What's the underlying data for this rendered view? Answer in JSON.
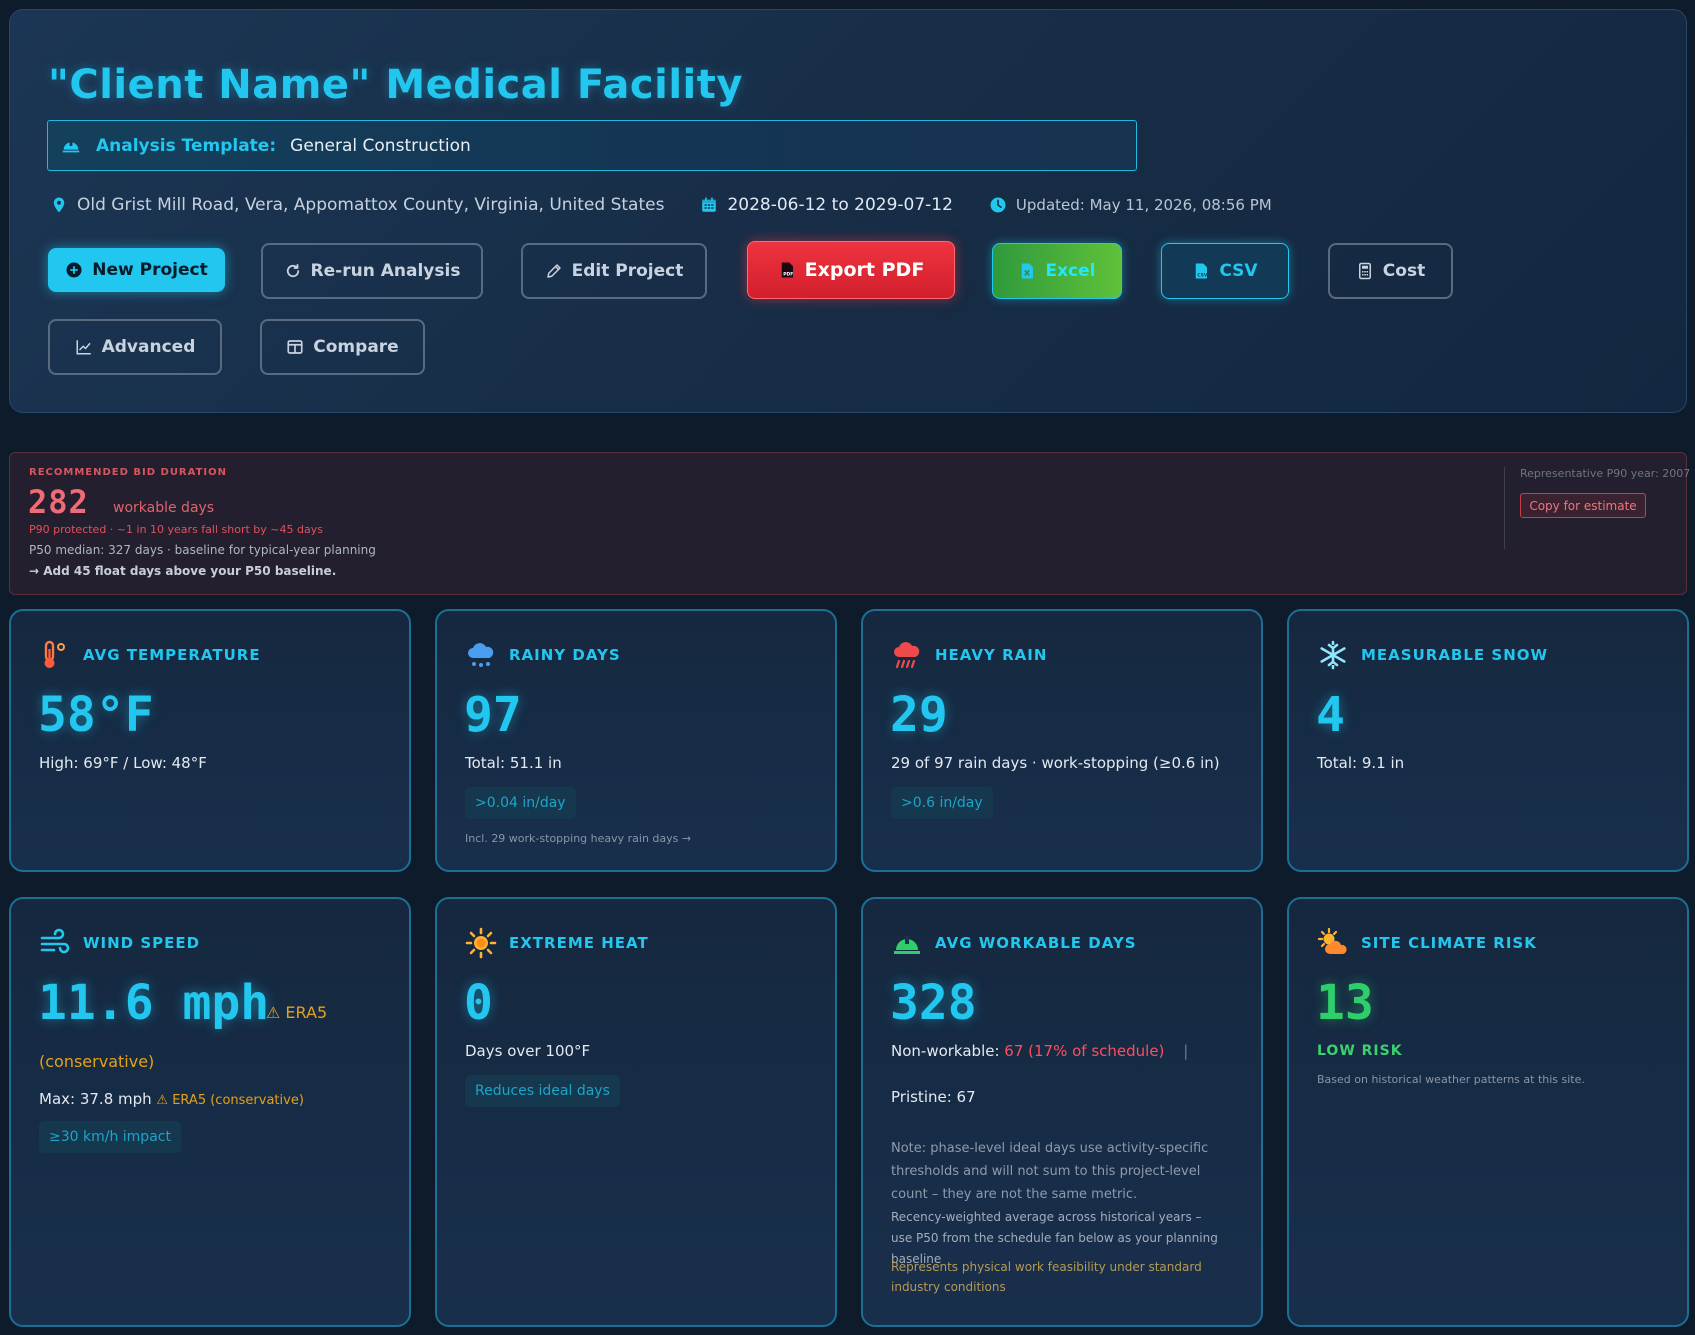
{
  "header": {
    "title": "\"Client Name\" Medical Facility",
    "template_label": "Analysis Template:",
    "template_value": "General Construction",
    "location": "Old Grist Mill Road, Vera, Appomattox County, Virginia, United States",
    "date_range": "2028-06-12 to 2029-07-12",
    "updated": "Updated: May 11, 2026, 08:56 PM"
  },
  "buttons": {
    "new_project": "New Project",
    "rerun": "Re-run Analysis",
    "edit": "Edit Project",
    "export_pdf": "Export PDF",
    "excel": "Excel",
    "csv": "CSV",
    "cost": "Cost",
    "advanced": "Advanced",
    "compare": "Compare"
  },
  "bid": {
    "label": "RECOMMENDED BID DURATION",
    "value": "282",
    "unit": "workable days",
    "p90": "P90 protected · ~1 in 10 years fall short by ~45 days",
    "p50": "P50 median: 327 days · baseline for typical-year planning",
    "float": "→ Add 45 float days above your P50 baseline.",
    "representative_year": "Representative P90 year: 2007",
    "copy_button": "Copy for estimate"
  },
  "cards": {
    "temp": {
      "title": "AVG TEMPERATURE",
      "value": "58°F",
      "line": "High: 69°F / Low: 48°F"
    },
    "rainy": {
      "title": "RAINY DAYS",
      "value": "97",
      "line": "Total: 51.1 in",
      "chip": ">0.04 in/day",
      "note": "Incl. 29 work-stopping heavy rain days →"
    },
    "heavy": {
      "title": "HEAVY RAIN",
      "value": "29",
      "line": "29 of 97 rain days · work-stopping (≥0.6 in)",
      "chip": ">0.6 in/day"
    },
    "snow": {
      "title": "MEASURABLE SNOW",
      "value": "4",
      "line": "Total: 9.1 in"
    },
    "wind": {
      "title": "WIND SPEED",
      "value": "11.6 mph",
      "badge": "⚠ ERA5",
      "badge_cont": "(conservative)",
      "max": "Max: 37.8 mph",
      "max_badge": "⚠ ERA5 (conservative)",
      "chip": "≥30 km/h impact"
    },
    "heat": {
      "title": "EXTREME HEAT",
      "value": "0",
      "line": "Days over 100°F",
      "chip": "Reduces ideal days"
    },
    "workable": {
      "title": "AVG WORKABLE DAYS",
      "value": "328",
      "nonwork_label": "Non-workable:",
      "nonwork_value": "67 (17% of schedule)",
      "pristine": "Pristine: 67",
      "note1": "Note: phase-level ideal days use activity-specific thresholds and will not sum to this project-level count – they are not the same metric.",
      "note2": "Recency-weighted average across historical years – use P50 from the schedule fan below as your planning baseline",
      "note3": "Represents physical work feasibility under standard industry conditions"
    },
    "risk": {
      "title": "SITE CLIMATE RISK",
      "value": "13",
      "level": "LOW RISK",
      "note": "Based on historical weather patterns at this site."
    }
  },
  "colors": {
    "accent": "#22c7ef",
    "danger": "#ef3340",
    "warning": "#e5a11a",
    "success": "#3dd06e",
    "background": "#0d1b2a"
  }
}
